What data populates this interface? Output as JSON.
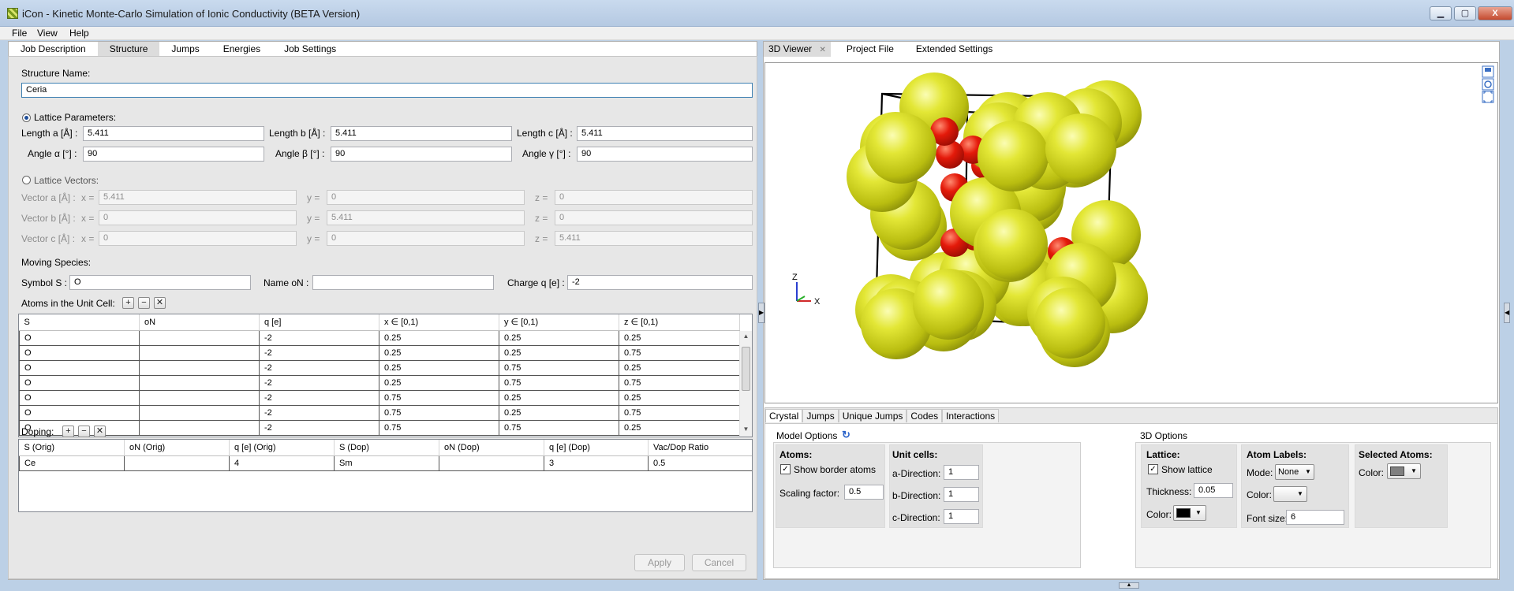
{
  "window": {
    "title": "iCon - Kinetic Monte-Carlo Simulation of Ionic Conductivity (BETA Version)",
    "minimize": "▁",
    "maximize": "▢",
    "close": "X"
  },
  "menu": [
    "File",
    "View",
    "Help"
  ],
  "left_tabs": [
    "Job Description",
    "Structure",
    "Jumps",
    "Energies",
    "Job Settings"
  ],
  "structure": {
    "name_label": "Structure Name:",
    "name_value": "Ceria",
    "lattice_params_label": "Lattice Parameters:",
    "length_a_label": "Length a [Å] :",
    "length_a": "5.411",
    "length_b_label": "Length b [Å] :",
    "length_b": "5.411",
    "length_c_label": "Length c [Å] :",
    "length_c": "5.411",
    "angle_a_label": "Angle α [°] :",
    "angle_a": "90",
    "angle_b_label": "Angle β [°] :",
    "angle_b": "90",
    "angle_g_label": "Angle γ [°] :",
    "angle_g": "90",
    "lattice_vectors_label": "Lattice Vectors:",
    "vectors": [
      {
        "label": "Vector a [Å] :",
        "x": "5.411",
        "y": "0",
        "z": "0"
      },
      {
        "label": "Vector b [Å] :",
        "x": "0",
        "y": "5.411",
        "z": "0"
      },
      {
        "label": "Vector c [Å] :",
        "x": "0",
        "y": "0",
        "z": "5.411"
      }
    ],
    "x_eq": "x =",
    "y_eq": "y =",
    "z_eq": "z =",
    "moving_species_label": "Moving Species:",
    "symbol_label": "Symbol S :",
    "symbol": "O",
    "name_on_label": "Name oN :",
    "name_on": "",
    "charge_label": "Charge q [e] :",
    "charge": "-2",
    "atoms_label": "Atoms in the Unit Cell:",
    "atoms_columns": [
      "S",
      "oN",
      "q [e]",
      "x ∈ [0,1)",
      "y ∈ [0,1)",
      "z ∈ [0,1)"
    ],
    "atoms_rows": [
      [
        "O",
        "",
        "-2",
        "0.25",
        "0.25",
        "0.25"
      ],
      [
        "O",
        "",
        "-2",
        "0.25",
        "0.25",
        "0.75"
      ],
      [
        "O",
        "",
        "-2",
        "0.25",
        "0.75",
        "0.25"
      ],
      [
        "O",
        "",
        "-2",
        "0.25",
        "0.75",
        "0.75"
      ],
      [
        "O",
        "",
        "-2",
        "0.75",
        "0.25",
        "0.25"
      ],
      [
        "O",
        "",
        "-2",
        "0.75",
        "0.25",
        "0.75"
      ],
      [
        "O",
        "",
        "-2",
        "0.75",
        "0.75",
        "0.25"
      ]
    ],
    "doping_label": "Doping:",
    "doping_columns": [
      "S (Orig)",
      "oN (Orig)",
      "q [e] (Orig)",
      "S (Dop)",
      "oN (Dop)",
      "q [e] (Dop)",
      "Vac/Dop Ratio"
    ],
    "doping_rows": [
      [
        "Ce",
        "",
        "4",
        "Sm",
        "",
        "3",
        "0.5"
      ]
    ],
    "apply": "Apply",
    "cancel": "Cancel",
    "add": "+",
    "remove": "−",
    "clear": "✕"
  },
  "right_tabs": [
    "3D Viewer",
    "Project File",
    "Extended Settings"
  ],
  "viewer": {
    "axis_z": "Z",
    "axis_x": "X",
    "tab_close": "✕"
  },
  "bottom_tabs": [
    "Crystal",
    "Jumps",
    "Unique Jumps",
    "Codes",
    "Interactions"
  ],
  "model_options": {
    "title": "Model Options",
    "atoms_title": "Atoms:",
    "show_border_atoms": "Show border atoms",
    "scaling_label": "Scaling factor:",
    "scaling": "0.5",
    "unit_cells_title": "Unit cells:",
    "a_dir_label": "a-Direction:",
    "a_dir": "1",
    "b_dir_label": "b-Direction:",
    "b_dir": "1",
    "c_dir_label": "c-Direction:",
    "c_dir": "1"
  },
  "options_3d": {
    "title": "3D Options",
    "lattice_title": "Lattice:",
    "show_lattice": "Show lattice",
    "thickness_label": "Thickness:",
    "thickness": "0.05",
    "color_label": "Color:",
    "labels_title": "Atom Labels:",
    "mode_label": "Mode:",
    "mode": "None",
    "font_size_label": "Font size:",
    "font_size": "6",
    "selected_title": "Selected Atoms:",
    "lattice_color": "#000000",
    "selected_color": "#808080"
  },
  "colors": {
    "cerium": "#d7dd1c",
    "oxygen": "#e01a0c",
    "accent": "#1f4e9a"
  }
}
